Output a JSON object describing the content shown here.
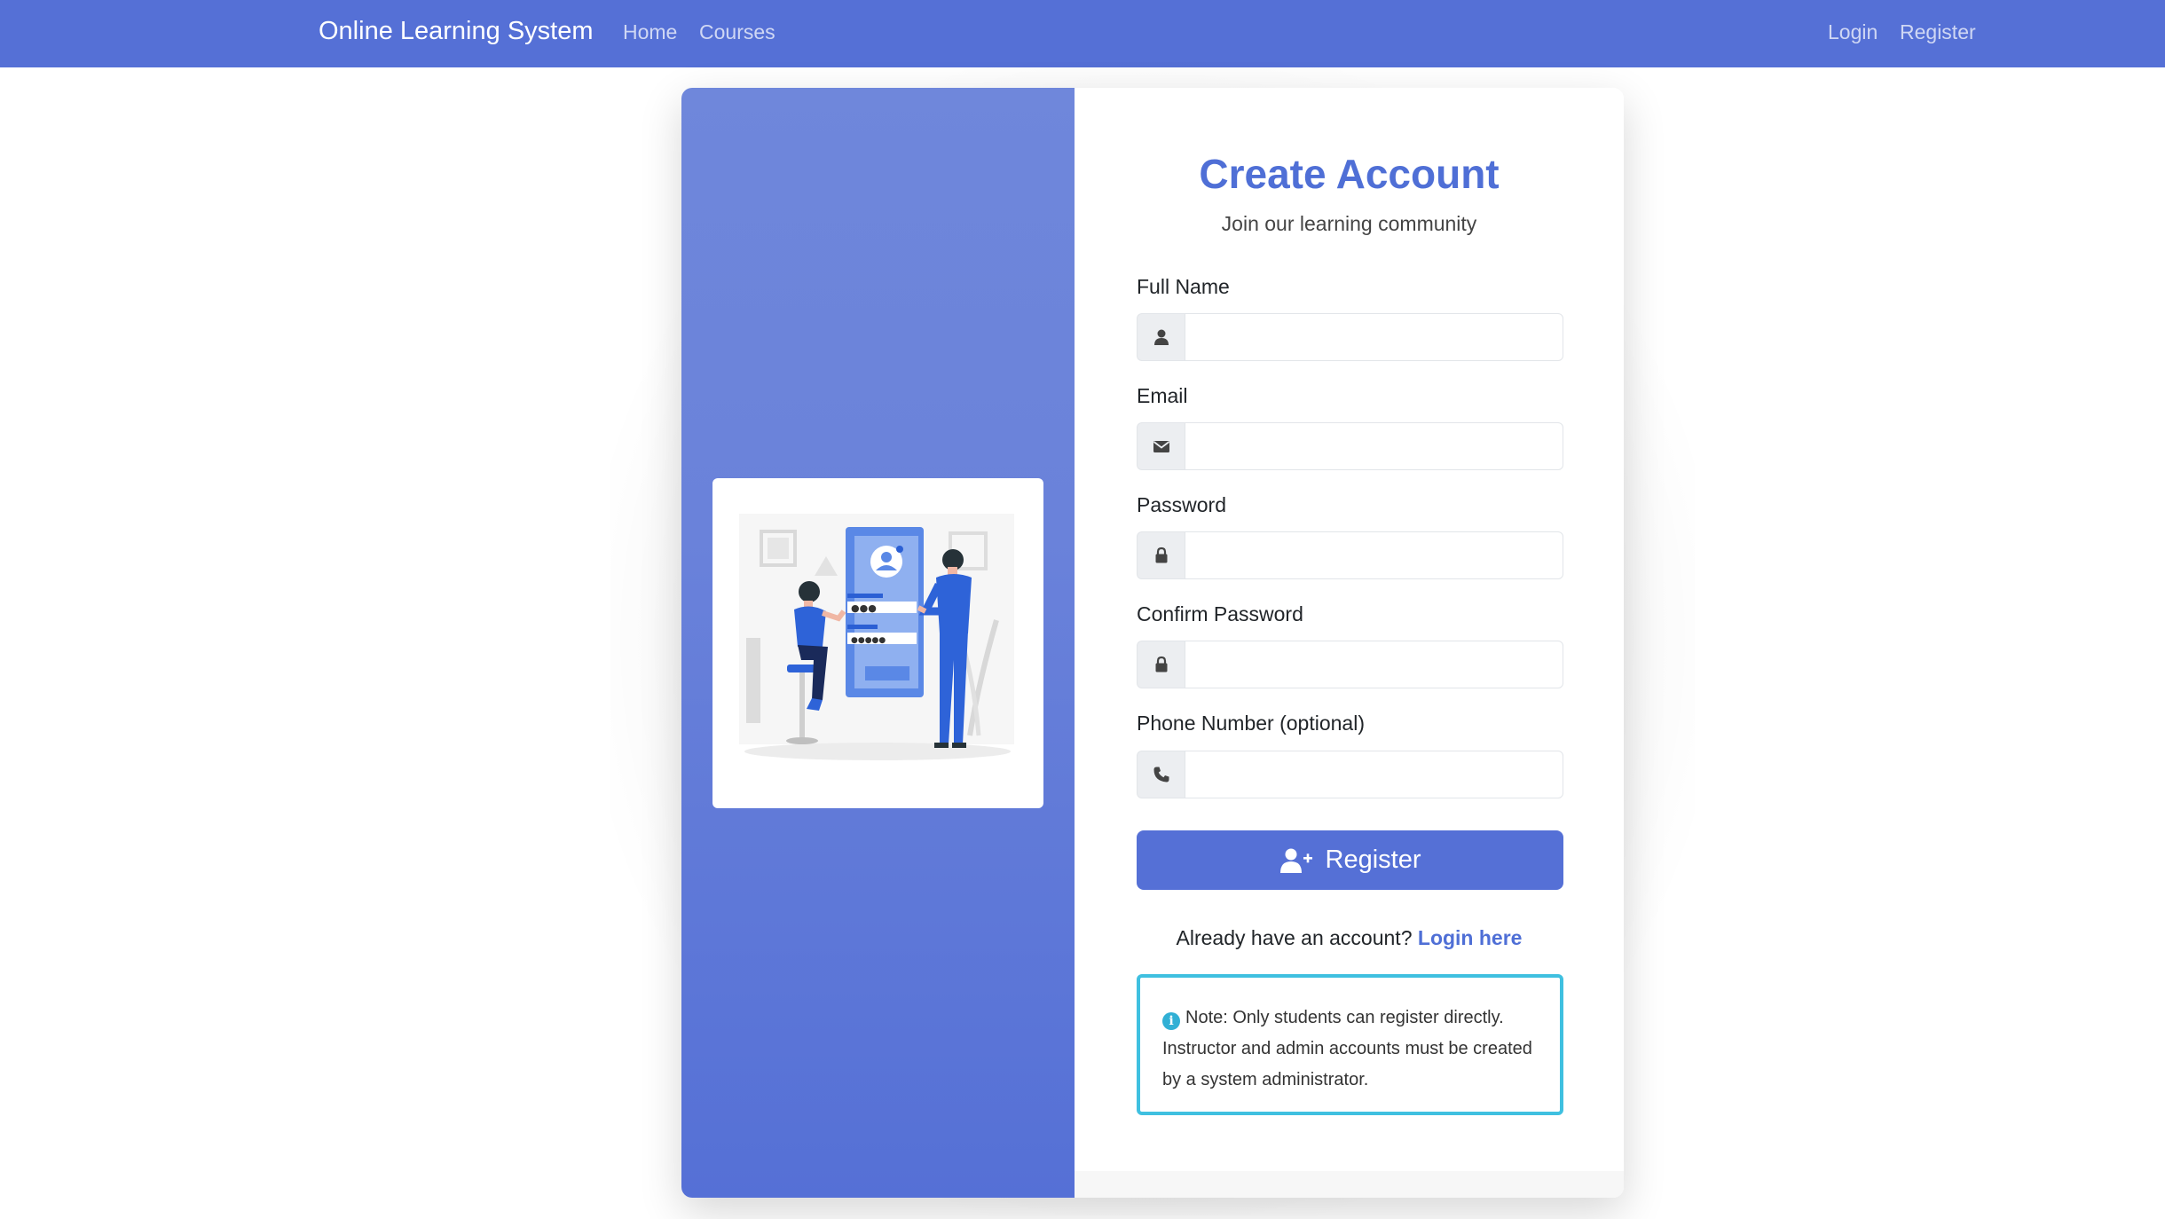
{
  "navbar": {
    "brand": "Online Learning System",
    "links": {
      "home": "Home",
      "courses": "Courses"
    },
    "auth": {
      "login": "Login",
      "register": "Register"
    },
    "color": "#5570d6"
  },
  "form": {
    "title": "Create Account",
    "subtitle": "Join our learning community",
    "fields": {
      "full_name": {
        "label": "Full Name",
        "value": "",
        "icon": "user-icon"
      },
      "email": {
        "label": "Email",
        "value": "",
        "icon": "envelope-icon"
      },
      "password": {
        "label": "Password",
        "value": "",
        "icon": "lock-icon"
      },
      "confirm_password": {
        "label": "Confirm Password",
        "value": "",
        "icon": "lock-icon"
      },
      "phone": {
        "label": "Phone Number (optional)",
        "value": "",
        "icon": "phone-icon"
      }
    },
    "submit_label": "Register",
    "submit_icon": "user-plus-icon",
    "login_prompt": "Already have an account?",
    "login_link": "Login here"
  },
  "note": {
    "icon": "info-icon",
    "text": "Note: Only students can register directly. Instructor and admin accounts must be created by a system administrator."
  },
  "illustration": {
    "name": "registration-illustration"
  },
  "colors": {
    "primary": "#5570d6",
    "title": "#4f6fd6",
    "note_border": "#3fc0e0"
  }
}
